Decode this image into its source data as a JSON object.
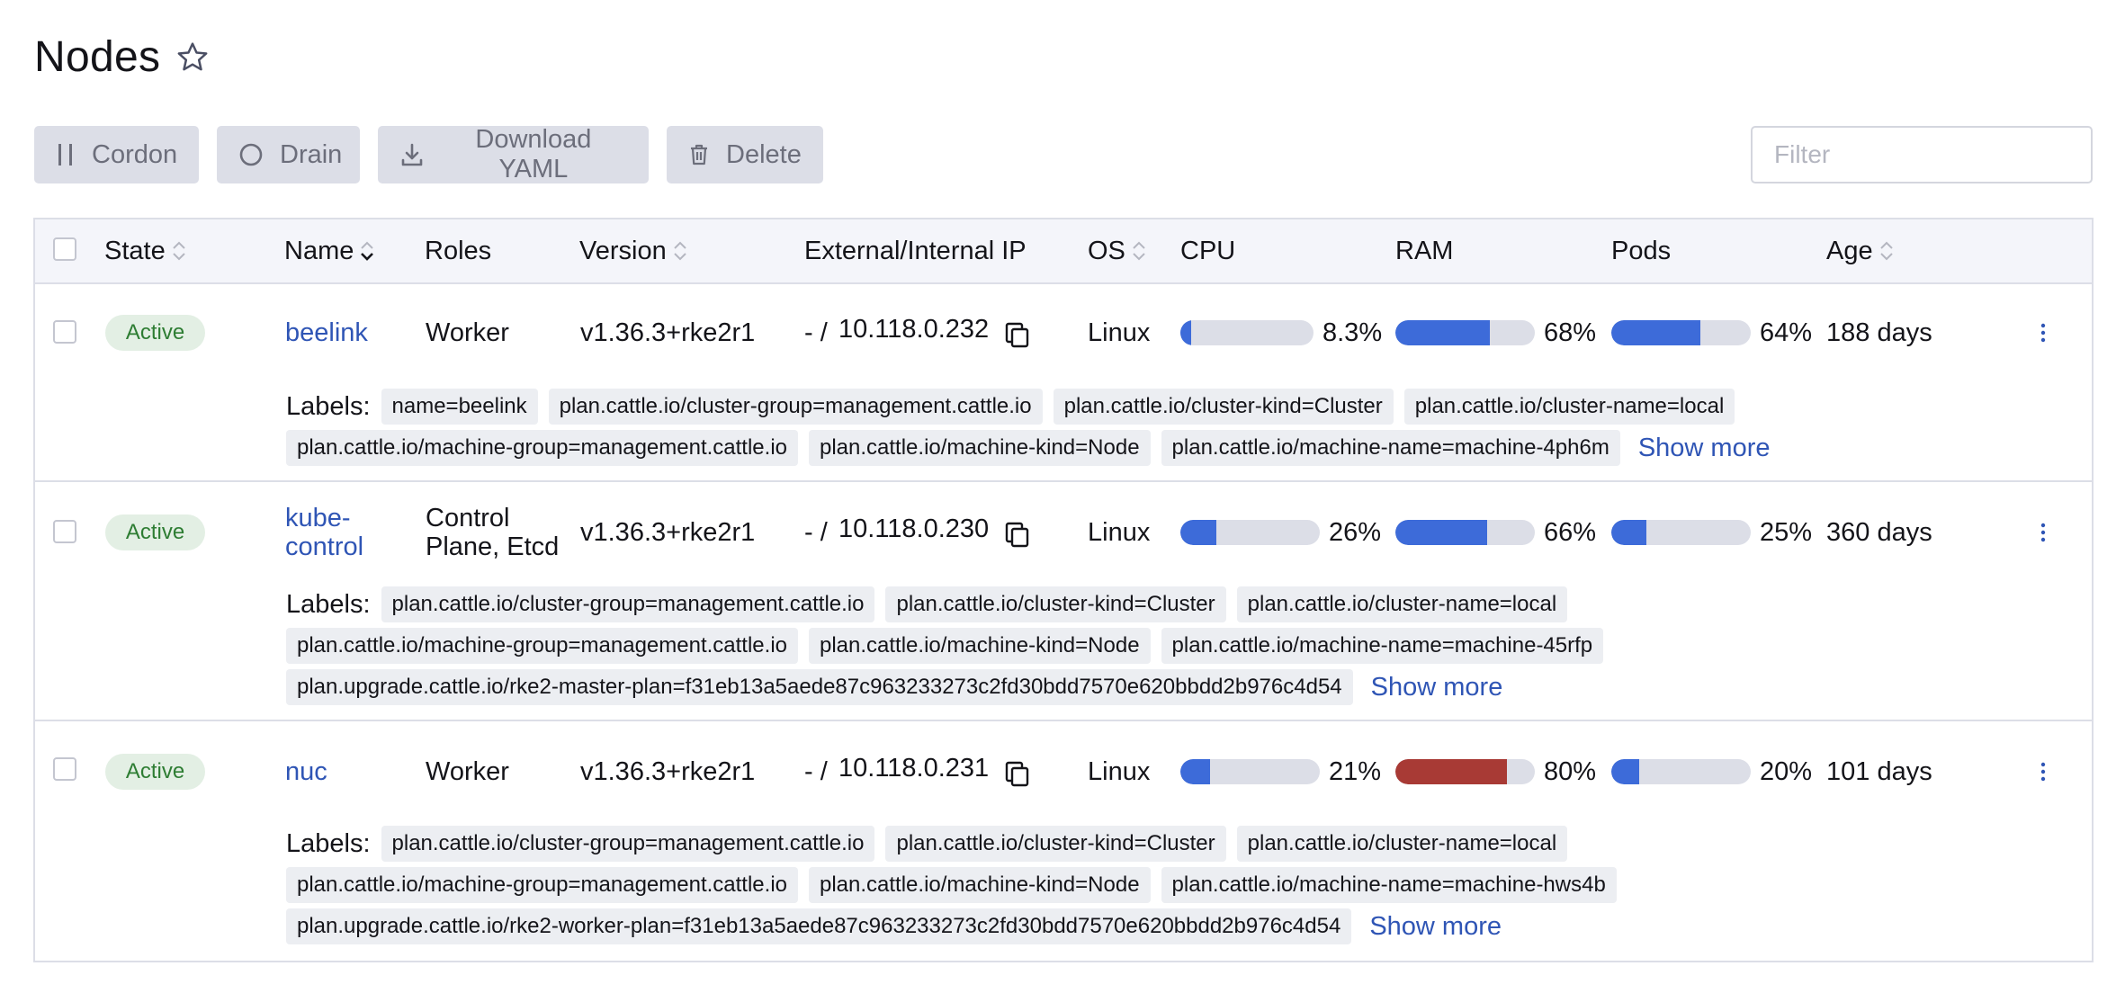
{
  "page": {
    "title": "Nodes"
  },
  "toolbar": {
    "cordon_label": "Cordon",
    "drain_label": "Drain",
    "download_label": "Download YAML",
    "delete_label": "Delete",
    "filter_placeholder": "Filter"
  },
  "columns": {
    "state": "State",
    "name": "Name",
    "roles": "Roles",
    "version": "Version",
    "ip": "External/Internal IP",
    "os": "OS",
    "cpu": "CPU",
    "ram": "RAM",
    "pods": "Pods",
    "age": "Age"
  },
  "labels_title": "Labels:",
  "show_more_label": "Show more",
  "colors": {
    "link": "#2f55b5",
    "bar_normal": "#3d6bd9",
    "bar_high": "#a83a35",
    "active_bg": "#e3efe4",
    "active_text": "#2e7d33"
  },
  "nodes": [
    {
      "state": "Active",
      "name": "beelink",
      "roles": "Worker",
      "version": "v1.36.3+rke2r1",
      "ip_external": "- /",
      "ip_internal": "10.118.0.232",
      "os": "Linux",
      "cpu": {
        "value": 8.3,
        "label": "8.3%"
      },
      "ram": {
        "value": 68,
        "label": "68%"
      },
      "pods": {
        "value": 64,
        "label": "64%"
      },
      "age": "188 days",
      "labels": [
        "name=beelink",
        "plan.cattle.io/cluster-group=management.cattle.io",
        "plan.cattle.io/cluster-kind=Cluster",
        "plan.cattle.io/cluster-name=local",
        "plan.cattle.io/machine-group=management.cattle.io",
        "plan.cattle.io/machine-kind=Node",
        "plan.cattle.io/machine-name=machine-4ph6m"
      ]
    },
    {
      "state": "Active",
      "name": "kube-control",
      "roles": "Control Plane, Etcd",
      "version": "v1.36.3+rke2r1",
      "ip_external": "- /",
      "ip_internal": "10.118.0.230",
      "os": "Linux",
      "cpu": {
        "value": 26,
        "label": "26%"
      },
      "ram": {
        "value": 66,
        "label": "66%"
      },
      "pods": {
        "value": 25,
        "label": "25%"
      },
      "age": "360 days",
      "labels": [
        "plan.cattle.io/cluster-group=management.cattle.io",
        "plan.cattle.io/cluster-kind=Cluster",
        "plan.cattle.io/cluster-name=local",
        "plan.cattle.io/machine-group=management.cattle.io",
        "plan.cattle.io/machine-kind=Node",
        "plan.cattle.io/machine-name=machine-45rfp",
        "plan.upgrade.cattle.io/rke2-master-plan=f31eb13a5aede87c963233273c2fd30bdd7570e620bbdd2b976c4d54"
      ]
    },
    {
      "state": "Active",
      "name": "nuc",
      "roles": "Worker",
      "version": "v1.36.3+rke2r1",
      "ip_external": "- /",
      "ip_internal": "10.118.0.231",
      "os": "Linux",
      "cpu": {
        "value": 21,
        "label": "21%"
      },
      "ram": {
        "value": 80,
        "label": "80%"
      },
      "pods": {
        "value": 20,
        "label": "20%"
      },
      "age": "101 days",
      "labels": [
        "plan.cattle.io/cluster-group=management.cattle.io",
        "plan.cattle.io/cluster-kind=Cluster",
        "plan.cattle.io/cluster-name=local",
        "plan.cattle.io/machine-group=management.cattle.io",
        "plan.cattle.io/machine-kind=Node",
        "plan.cattle.io/machine-name=machine-hws4b",
        "plan.upgrade.cattle.io/rke2-worker-plan=f31eb13a5aede87c963233273c2fd30bdd7570e620bbdd2b976c4d54"
      ]
    }
  ]
}
